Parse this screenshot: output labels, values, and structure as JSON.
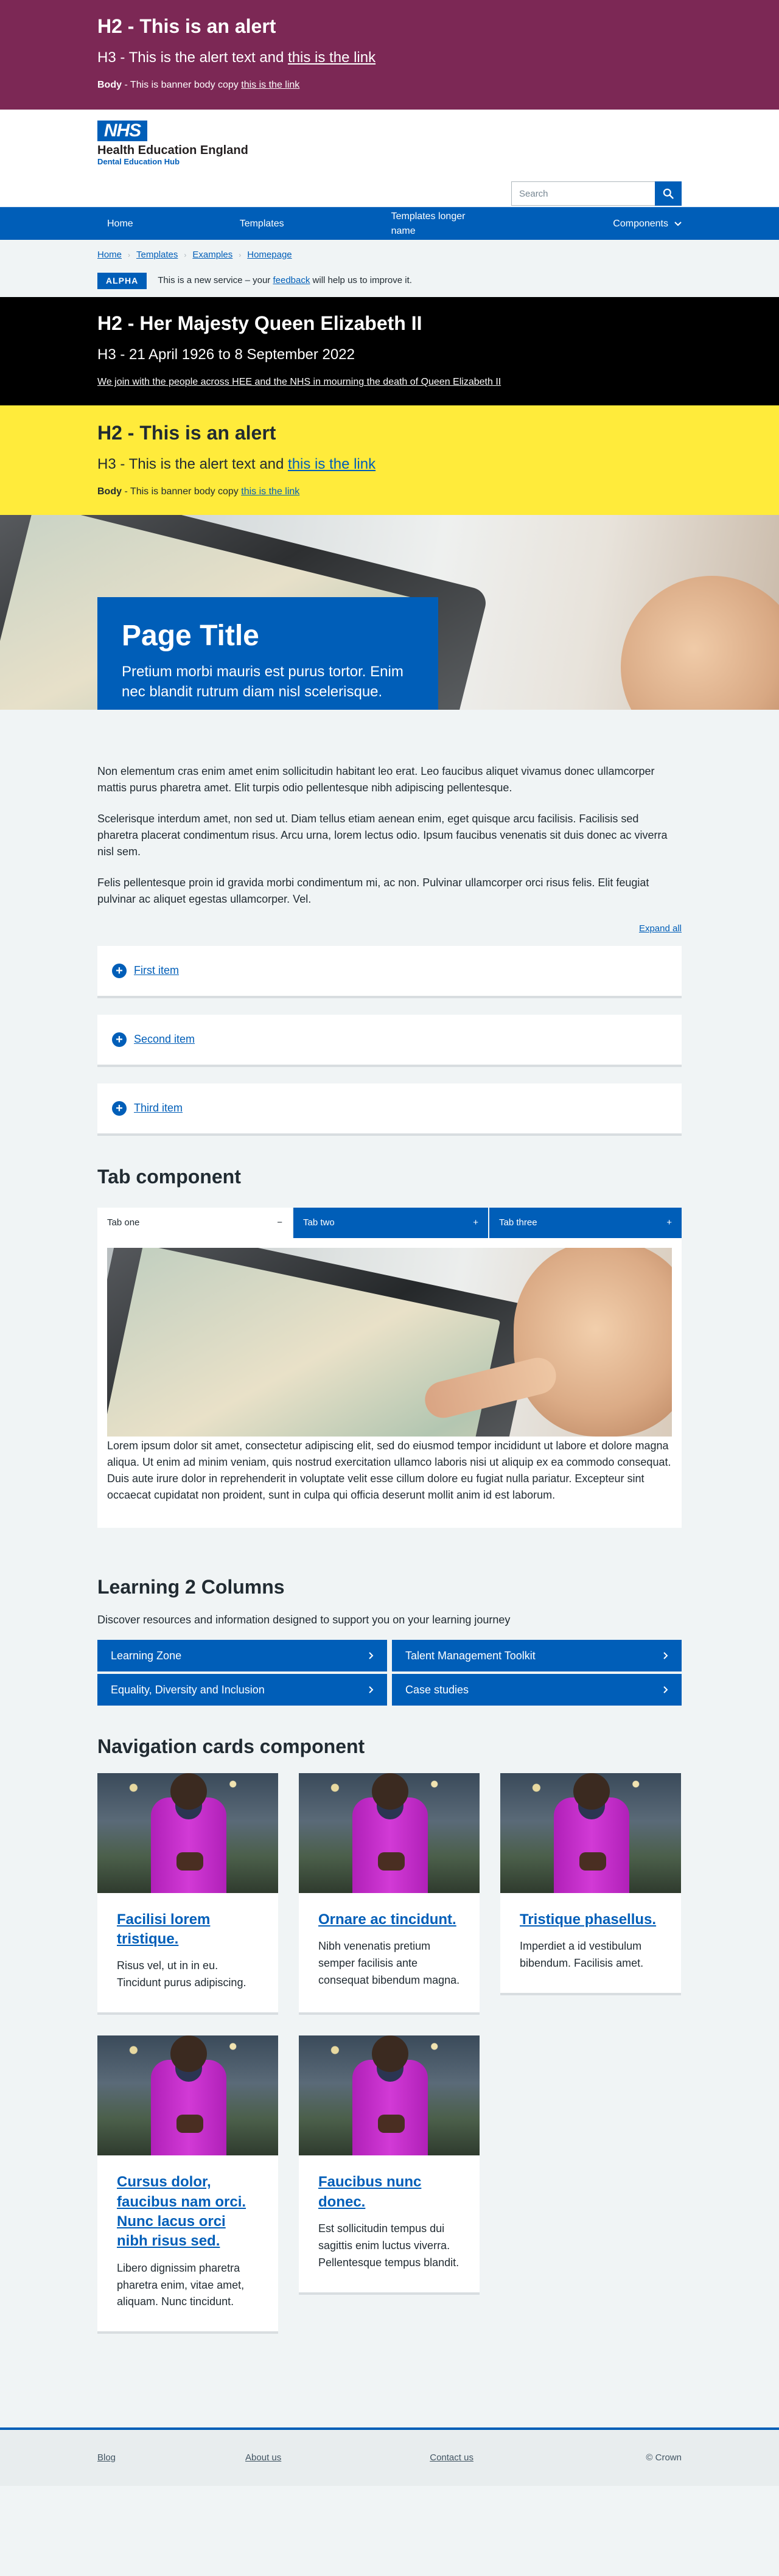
{
  "alert_purple": {
    "h2": "H2 - This is an alert",
    "h3_text": "H3 - This is the alert text and ",
    "h3_link": "this is the link",
    "body_label": "Body",
    "body_text": " - This is banner body copy ",
    "body_link": "this is the link"
  },
  "header": {
    "logo": "NHS",
    "org_name": "Health Education England",
    "org_sub": "Dental Education Hub",
    "search_placeholder": "Search"
  },
  "nav": {
    "items": [
      "Home",
      "Templates",
      "Templates longer name",
      "Components"
    ]
  },
  "breadcrumb": [
    "Home",
    "Templates",
    "Examples",
    "Homepage"
  ],
  "phase": {
    "tag": "ALPHA",
    "text_before": "This is a new service – your ",
    "link": "feedback",
    "text_after": " will help us to improve it."
  },
  "alert_black": {
    "h2": "H2 - Her Majesty Queen Elizabeth II",
    "h3": "H3 - 21 April 1926 to 8 September 2022",
    "link": "We join with the people across HEE and the NHS in mourning the death of Queen Elizabeth II"
  },
  "alert_yellow": {
    "h2": "H2 - This is an alert",
    "h3_text": "H3 - This is the alert text and ",
    "h3_link": "this is the link",
    "body_label": "Body",
    "body_text": " - This is banner body copy ",
    "body_link": "this is the link"
  },
  "hero": {
    "title": "Page Title",
    "subtitle": "Pretium morbi mauris est purus tortor. Enim nec blandit rutrum diam nisl scelerisque."
  },
  "content": {
    "paragraphs": [
      "Non elementum cras enim amet enim sollicitudin habitant leo erat. Leo faucibus aliquet vivamus donec ullamcorper mattis purus pharetra amet. Elit turpis odio pellentesque nibh adipiscing pellentesque.",
      "Scelerisque interdum amet, non sed ut. Diam tellus etiam aenean enim, eget quisque arcu facilisis. Facilisis sed pharetra placerat condimentum risus. Arcu urna, lorem lectus odio. Ipsum faucibus venenatis sit duis donec ac viverra nisl sem.",
      "Felis pellentesque proin id gravida morbi condimentum mi, ac non. Pulvinar ullamcorper orci risus felis. Elit feugiat pulvinar ac aliquet egestas ullamcorper. Vel."
    ],
    "expand_all": "Expand all"
  },
  "accordion": [
    "First item",
    "Second item",
    "Third item"
  ],
  "tabs": {
    "heading": "Tab component",
    "items": [
      {
        "label": "Tab one",
        "icon": "−"
      },
      {
        "label": "Tab two",
        "icon": "+"
      },
      {
        "label": "Tab three",
        "icon": "+"
      }
    ],
    "panel_text": "Lorem ipsum dolor sit amet, consectetur adipiscing elit, sed do eiusmod tempor incididunt ut labore et dolore magna aliqua. Ut enim ad minim veniam, quis nostrud exercitation ullamco laboris nisi ut aliquip ex ea commodo consequat. Duis aute irure dolor in reprehenderit in voluptate velit esse cillum dolore eu fugiat nulla pariatur. Excepteur sint occaecat cupidatat non proident, sunt in culpa qui officia deserunt mollit anim id est laborum."
  },
  "learning": {
    "heading": "Learning 2 Columns",
    "lead": "Discover resources and information designed to support you on your learning journey",
    "links": [
      "Learning Zone",
      "Talent Management Toolkit",
      "Equality, Diversity and Inclusion",
      "Case studies"
    ]
  },
  "navcards": {
    "heading": "Navigation cards component",
    "cards": [
      {
        "title": "Facilisi lorem tristique.",
        "text": "Risus vel, ut in in eu. Tincidunt purus adipiscing."
      },
      {
        "title": "Ornare ac tincidunt.",
        "text": "Nibh venenatis pretium semper facilisis ante consequat bibendum magna."
      },
      {
        "title": "Tristique phasellus.",
        "text": "Imperdiet a id vestibulum bibendum. Facilisis amet."
      },
      {
        "title": "Cursus dolor, faucibus nam orci. Nunc lacus orci nibh risus sed.",
        "text": "Libero dignissim pharetra pharetra enim, vitae amet, aliquam. Nunc tincidunt."
      },
      {
        "title": "Faucibus nunc donec.",
        "text": "Est sollicitudin tempus dui sagittis enim luctus viverra. Pellentesque tempus blandit."
      }
    ]
  },
  "footer": {
    "links": [
      "Blog",
      "About us",
      "Contact us"
    ],
    "copyright": "© Crown"
  }
}
